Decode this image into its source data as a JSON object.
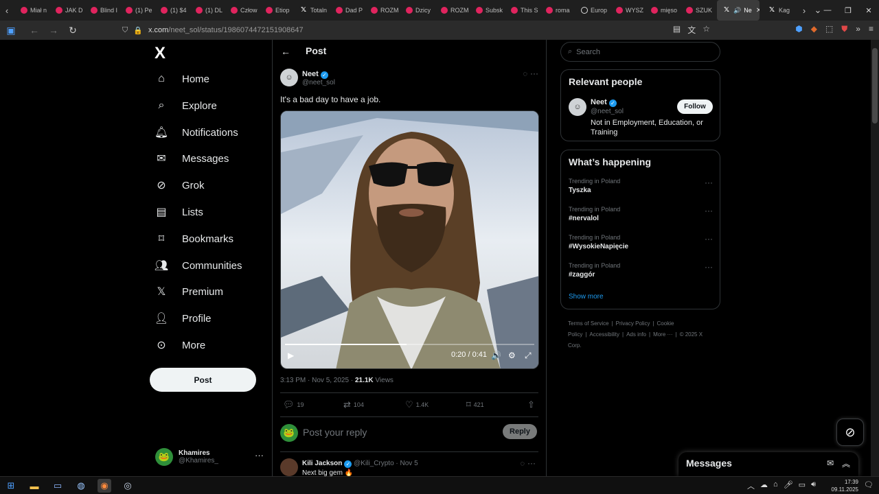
{
  "browser": {
    "tabs": [
      {
        "label": "Miał n",
        "icon": "youtube"
      },
      {
        "label": "JAK D",
        "icon": "youtube"
      },
      {
        "label": "Blind I",
        "icon": "youtube"
      },
      {
        "label": "(1) Pe",
        "icon": "youtube"
      },
      {
        "label": "(1) $4",
        "icon": "youtube"
      },
      {
        "label": "(1) DL",
        "icon": "youtube"
      },
      {
        "label": "Człow",
        "icon": "youtube"
      },
      {
        "label": "Etiop",
        "icon": "youtube"
      },
      {
        "label": "Totaln",
        "icon": "x"
      },
      {
        "label": "Dad P",
        "icon": "youtube"
      },
      {
        "label": "ROZM",
        "icon": "youtube"
      },
      {
        "label": "Dzicy",
        "icon": "youtube"
      },
      {
        "label": "ROZM",
        "icon": "youtube"
      },
      {
        "label": "Subsk",
        "icon": "youtube"
      },
      {
        "label": "This S",
        "icon": "youtube"
      },
      {
        "label": "roma",
        "icon": "youtube"
      },
      {
        "label": "Europ",
        "icon": "globe"
      },
      {
        "label": "WYSZ",
        "icon": "youtube"
      },
      {
        "label": "mięso",
        "icon": "youtube"
      },
      {
        "label": "SZUK",
        "icon": "youtube"
      }
    ],
    "active_tab": {
      "label": "Ne",
      "icon": "x"
    },
    "after_tab": {
      "label": "Kag",
      "icon": "x"
    },
    "url_host": "x.com",
    "url_path": "/neet_sol/status/1986074472151908647",
    "accent_colors": {
      "x_blue": "#1d9bf0",
      "youtube_red": "#e0245e"
    }
  },
  "leftnav": {
    "logo": "X",
    "items": [
      {
        "label": "Home",
        "icon": "home-icon"
      },
      {
        "label": "Explore",
        "icon": "search-icon"
      },
      {
        "label": "Notifications",
        "icon": "bell-icon"
      },
      {
        "label": "Messages",
        "icon": "envelope-icon"
      },
      {
        "label": "Grok",
        "icon": "grok-icon"
      },
      {
        "label": "Lists",
        "icon": "list-icon"
      },
      {
        "label": "Bookmarks",
        "icon": "bookmark-icon"
      },
      {
        "label": "Communities",
        "icon": "people-icon"
      },
      {
        "label": "Premium",
        "icon": "x-icon"
      },
      {
        "label": "Profile",
        "icon": "person-icon"
      },
      {
        "label": "More",
        "icon": "more-circle-icon"
      }
    ],
    "post_button": "Post",
    "account": {
      "name": "Khamires",
      "handle": "@Khamires_"
    }
  },
  "main": {
    "header_title": "Post",
    "tweet": {
      "author_name": "Neet",
      "author_handle": "@neet_sol",
      "text": "It's a bad day to have a job.",
      "video": {
        "current": "0:20",
        "duration": "0:41",
        "progress_fraction": 0.488
      },
      "time": "3:13 PM · Nov 5, 2025 · ",
      "views_count": "21.1K",
      "views_label": " Views",
      "stats": {
        "replies": "19",
        "reposts": "104",
        "likes": "1.4K",
        "bookmarks": "421"
      }
    },
    "reply_placeholder": "Post your reply",
    "reply_button": "Reply",
    "first_reply": {
      "name": "Kili Jackson",
      "handle": "@Kili_Crypto · Nov 5",
      "text": "Next big gem 🔥"
    }
  },
  "right": {
    "search_placeholder": "Search",
    "relevant_people": {
      "title": "Relevant people",
      "name": "Neet",
      "handle": "@neet_sol",
      "bio": "Not in Employment, Education, or Training",
      "follow_label": "Follow"
    },
    "whats_happening": {
      "title": "What’s happening",
      "trends": [
        {
          "context": "Trending in Poland",
          "topic": "Tyszka"
        },
        {
          "context": "Trending in Poland",
          "topic": "#nervalol"
        },
        {
          "context": "Trending in Poland",
          "topic": "#WysokieNapięcie"
        },
        {
          "context": "Trending in Poland",
          "topic": "#zaggór"
        }
      ],
      "show_more": "Show more"
    },
    "footer": {
      "links": [
        "Terms of Service",
        "|",
        "Privacy Policy",
        "|",
        "Cookie Policy",
        "|",
        "Accessibility",
        "|",
        "Ads info",
        "|",
        "More ···",
        "|",
        "© 2025 X Corp."
      ]
    },
    "messages_drawer_title": "Messages"
  },
  "taskbar": {
    "time": "17:39",
    "date": "09.11.2025"
  }
}
